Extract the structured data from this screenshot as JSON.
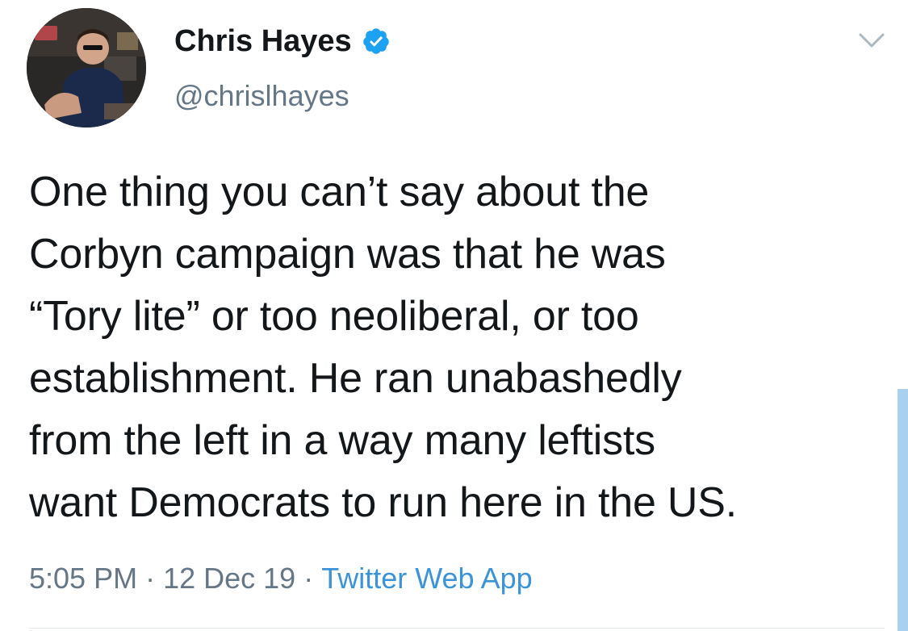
{
  "author": {
    "display_name": "Chris Hayes",
    "handle": "@chrislhayes",
    "verified": true,
    "avatar_icon": "profile-photo"
  },
  "tweet": {
    "text": "One thing you can’t say about the\nCorbyn campaign was that he was\n“Tory lite” or too neoliberal, or too\nestablishment. He ran unabashedly\nfrom the left in a way many leftists\nwant Democrats to run here in the US."
  },
  "meta": {
    "time": "5:05 PM",
    "date": "12 Dec 19",
    "separator": "·",
    "source": "Twitter Web App"
  },
  "icons": {
    "menu": "chevron-down-icon",
    "verified": "verified-badge-icon"
  },
  "colors": {
    "text": "#14171a",
    "secondary": "#657786",
    "link": "#3b94d9",
    "verified": "#1da1f2"
  }
}
